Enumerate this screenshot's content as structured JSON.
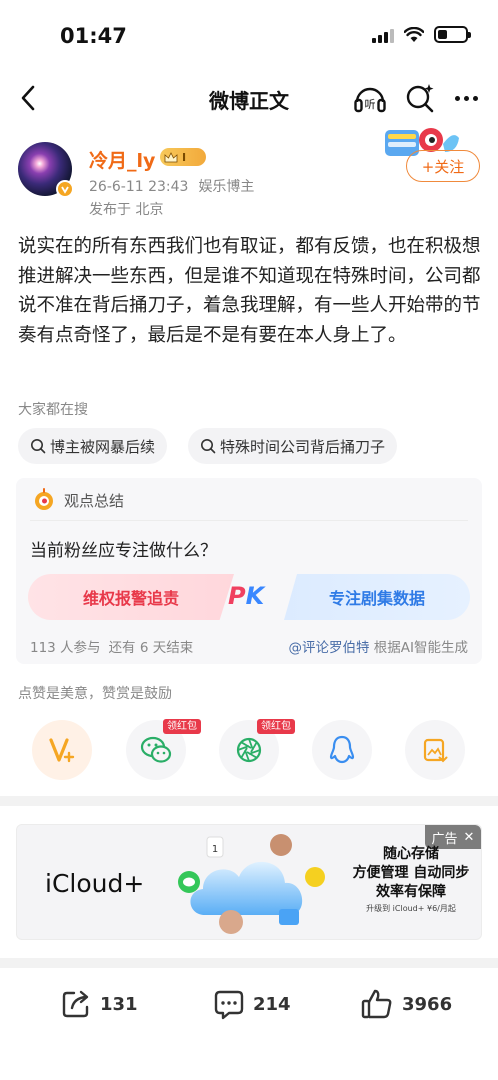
{
  "status_bar": {
    "time": "01:47"
  },
  "nav": {
    "title": "微博正文",
    "listen_label": "听"
  },
  "author": {
    "name": "冷月_ly",
    "vip_level": "I",
    "post_time": "26-6-11 23:43",
    "category": "娱乐博主",
    "location": "发布于 北京",
    "follow_label": "+关注"
  },
  "post": {
    "text": "说实在的所有东西我们也有取证，都有反馈，也在积极想推进解决一些东西，但是谁不知道现在特殊时间，公司都说不准在背后捅刀子，着急我理解，有一些人开始带的节奏有点奇怪了，最后是不是有要在本人身上了。"
  },
  "hot_search": {
    "label": "大家都在搜",
    "items": [
      "博主被网暴后续",
      "特殊时间公司背后捅刀子"
    ]
  },
  "opinion": {
    "header": "观点总结",
    "question": "当前粉丝应专注做什么？",
    "option_left": "维权报警追责",
    "option_right": "专注剧集数据",
    "pk_p": "P",
    "pk_k": "K",
    "participants": "113 人参与",
    "remaining": "还有 6 天结束",
    "source_mention": "@评论罗伯特",
    "source_suffix": " 根据AI智能生成"
  },
  "actions": {
    "hint": "点赞是美意，赞赏是鼓励",
    "red_packet_tag": "领红包"
  },
  "ad": {
    "tag": "广告",
    "brand": "iCloud+",
    "line1": "随心存储",
    "line2": "方便管理 自动同步",
    "line3": "效率有保障",
    "small": "升级到 iCloud+ ¥6/月起"
  },
  "bottom": {
    "reposts": "131",
    "comments": "214",
    "likes": "3966"
  },
  "colors": {
    "accent_orange": "#f06a16",
    "pk_red": "#e8394a",
    "pk_blue": "#2f7be6"
  }
}
